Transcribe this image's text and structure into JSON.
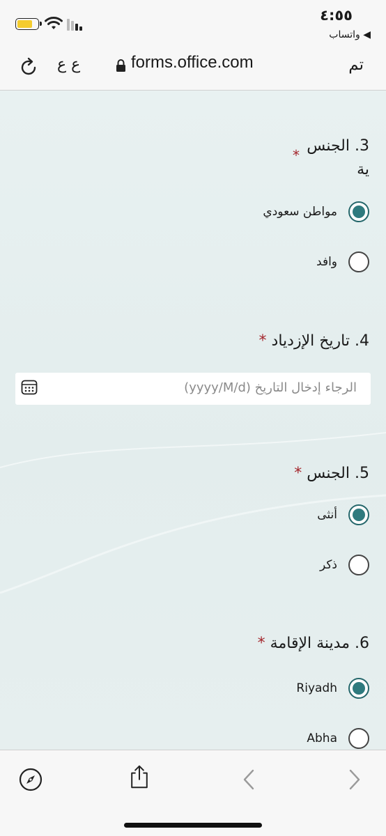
{
  "status_bar": {
    "time": "٤:٥٥",
    "back_app": "◀ واتساب"
  },
  "browser": {
    "text_size_label": "ع ع",
    "url": "forms.office.com",
    "done_label": "تم"
  },
  "questions": [
    {
      "number_title": "3. الجنس",
      "subline": "ية",
      "required": "*",
      "options": [
        {
          "label": "مواطن سعودي",
          "selected": true
        },
        {
          "label": "وافد",
          "selected": false
        }
      ]
    },
    {
      "number_title": "4. تاريخ الإزدياد",
      "required": "*",
      "date_placeholder": "الرجاء إدخال التاريخ (yyyy/M/d)"
    },
    {
      "number_title": "5. الجنس",
      "required": "*",
      "options": [
        {
          "label": "أنثى",
          "selected": true
        },
        {
          "label": "ذكر",
          "selected": false
        }
      ]
    },
    {
      "number_title": "6. مدينة الإقامة",
      "required": "*",
      "options": [
        {
          "label": "Riyadh",
          "selected": true
        },
        {
          "label": "Abha",
          "selected": false
        }
      ]
    }
  ],
  "toolbar": {
    "icons": [
      "compass-icon",
      "share-icon",
      "back-chevron-icon",
      "forward-chevron-icon"
    ]
  },
  "colors": {
    "accent": "#2f7a7e",
    "required": "#a4262c",
    "background": "#e8f1f1"
  }
}
